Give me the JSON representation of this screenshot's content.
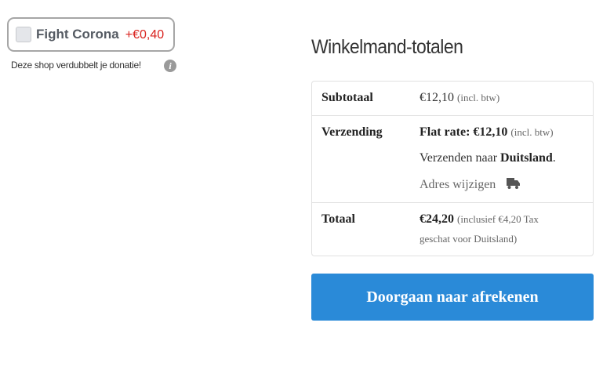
{
  "donation": {
    "label": "Fight Corona",
    "amount": "+€0,40",
    "note": "Deze shop verdubbelt je donatie!",
    "info_glyph": "i"
  },
  "totals": {
    "title": "Winkelmand-totalen",
    "subtotal": {
      "label": "Subtotaal",
      "amount": "€12,10",
      "tax_note": "(incl. btw)"
    },
    "shipping": {
      "label": "Verzending",
      "rate_label": "Flat rate: €12,10",
      "tax_note": "(incl. btw)",
      "ship_to_prefix": "Verzenden naar",
      "country": "Duitsland",
      "ship_to_suffix": ".",
      "change_address": "Adres wijzigen"
    },
    "total": {
      "label": "Totaal",
      "amount": "€24,20",
      "tax_note_line1": "(inclusief €4,20 Tax",
      "tax_note_line2": "geschat voor Duitsland)"
    }
  },
  "checkout_button": "Doorgaan naar afrekenen",
  "colors": {
    "accent": "#2a8ad8",
    "donation_amount": "#d9231f"
  },
  "icons": {
    "info": "info-icon",
    "shipping": "truck-icon"
  }
}
